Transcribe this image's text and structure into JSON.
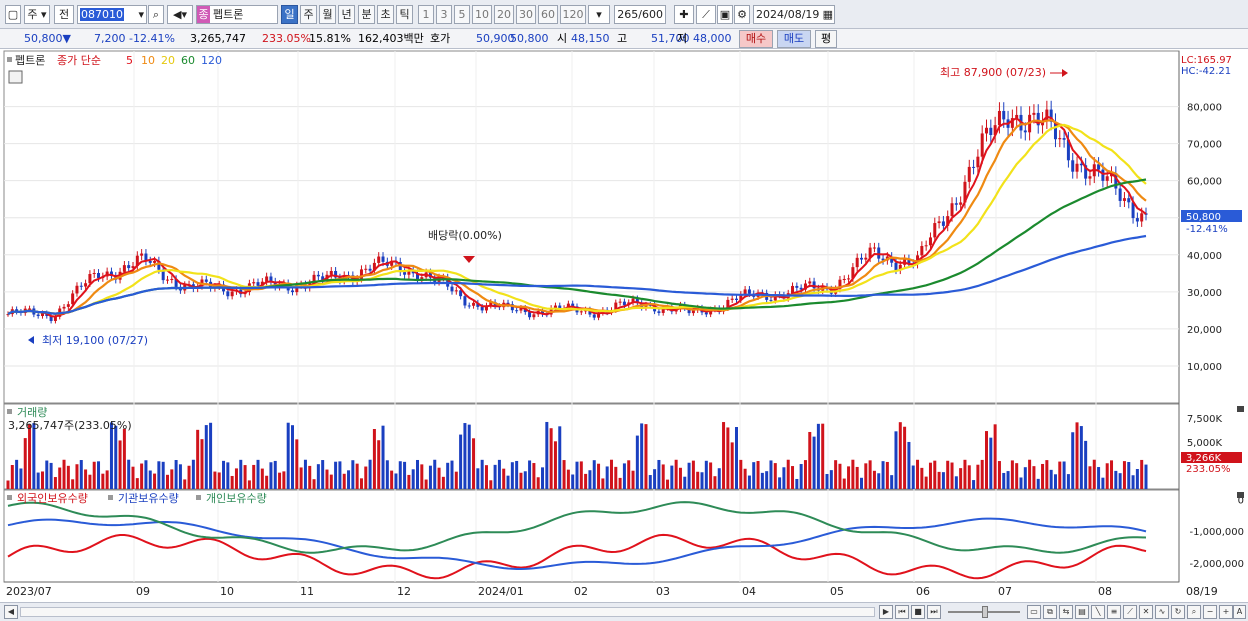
{
  "toolbar": {
    "period_type": "주",
    "prev_label": "전",
    "stock_code": "087010",
    "stock_name": "펩트론",
    "name_tag": "종",
    "period_buttons": [
      "일",
      "주",
      "월",
      "년",
      "분",
      "초",
      "틱"
    ],
    "active_period": "일",
    "interval_buttons": [
      "1",
      "3",
      "5",
      "10",
      "20",
      "30",
      "60",
      "120"
    ],
    "count": "265",
    "count_total": "/600",
    "date": "2024/08/19"
  },
  "quote": {
    "price": "50,800",
    "change": "7,200",
    "change_pct": "-12.41%",
    "volume": "3,265,747",
    "volume_ratio": "233.05%",
    "turnover": "15.81%",
    "amount": "162,403백만",
    "bid_label": "호가",
    "bid1": "50,900",
    "bid2": "50,800",
    "open_label": "시",
    "open": "48,150",
    "high_label": "고",
    "high": "51,700",
    "low_label": "저",
    "low": "48,000",
    "buy_label": "매수",
    "sell_label": "매도",
    "flat_label": "평"
  },
  "price_pane": {
    "legend_name": "펩트론",
    "legend_ma_label": "종가 단순",
    "ma_periods": [
      "5",
      "10",
      "20",
      "60",
      "120"
    ],
    "lc_label": "LC:165.97",
    "hc_label": "HC:-42.21",
    "high_annotation": "최고 87,900 (07/23)",
    "low_annotation": "최저 19,100 (07/27)",
    "dividend_annotation": "배당락(0.00%)",
    "y_ticks": [
      "80,000",
      "70,000",
      "60,000",
      "50,000",
      "40,000",
      "30,000",
      "20,000",
      "10,000"
    ],
    "y_tick_values": [
      80000,
      70000,
      60000,
      50000,
      40000,
      30000,
      20000,
      10000
    ],
    "current_price_label": "50,800",
    "current_change_label": "-12.41%"
  },
  "volume_pane": {
    "title": "거래량",
    "readout": "3,265,747주(233.05%)",
    "y_ticks": [
      "7,500K",
      "5,000K"
    ],
    "y_tick_values": [
      7500000,
      5000000
    ],
    "current_label": "3,266K",
    "current_pct": "233.05%"
  },
  "holding_pane": {
    "series_labels": [
      "외국인보유수량",
      "기관보유수량",
      "개인보유수량"
    ],
    "y_ticks": [
      "0",
      "-1,000,000",
      "-2,000,000"
    ],
    "y_tick_values": [
      0,
      -1000000,
      -2000000
    ]
  },
  "x_axis": {
    "labels": [
      "2023/07",
      "09",
      "10",
      "11",
      "12",
      "2024/01",
      "02",
      "03",
      "04",
      "05",
      "06",
      "07",
      "08",
      "08/19"
    ]
  },
  "colors": {
    "up": "#d0131b",
    "down": "#1a3fc0",
    "ma5": "#e0121c",
    "ma10": "#ef8a12",
    "ma20": "#f2e21a",
    "ma60": "#1b8a2e",
    "ma120": "#2a5bd7",
    "foreign": "#e0121c",
    "institution": "#2a5bd7",
    "individual": "#2e8b57"
  },
  "chart_data": {
    "type": "candlestick",
    "title": "펩트론",
    "price_range": [
      0,
      95000
    ],
    "months": [
      "2023/07",
      "09",
      "10",
      "11",
      "12",
      "2024/01",
      "02",
      "03",
      "04",
      "05",
      "06",
      "07",
      "08"
    ],
    "close_by_period": [
      24000,
      24000,
      35000,
      38000,
      31000,
      31000,
      32000,
      33000,
      37000,
      36000,
      28000,
      25000,
      25000,
      25000,
      27000,
      24000,
      28000,
      30000,
      31000,
      40000,
      38000,
      60000,
      80000,
      72000,
      60000,
      50800
    ],
    "highest": {
      "value": 87900,
      "date": "07/23"
    },
    "lowest": {
      "value": 19100,
      "date": "07/27"
    },
    "last": {
      "close": 50800,
      "change_pct": -12.41
    },
    "ma120_end": 41000,
    "ma60_end": 55000,
    "ma20_end": 66000
  }
}
